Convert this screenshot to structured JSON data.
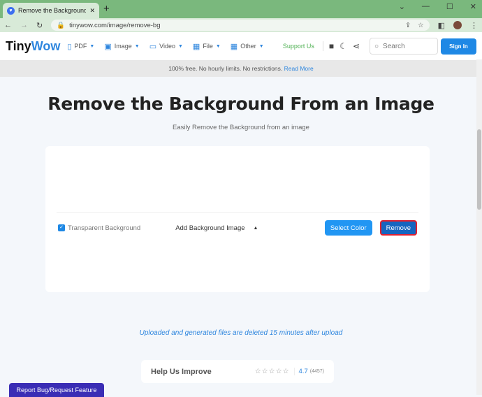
{
  "browser": {
    "tab_title": "Remove the Background From an Image",
    "url": "tinywow.com/image/remove-bg",
    "new_tab": "+",
    "close": "✕"
  },
  "nav": {
    "logo_a": "Tiny",
    "logo_b": "Wow",
    "items": [
      {
        "label": "PDF",
        "icon": "📄"
      },
      {
        "label": "Image",
        "icon": "🖼"
      },
      {
        "label": "Video",
        "icon": "🎥"
      },
      {
        "label": "File",
        "icon": "▦"
      },
      {
        "label": "Other",
        "icon": "▦"
      }
    ],
    "support": "Support Us",
    "search_placeholder": "Search",
    "signin": "Sign In"
  },
  "banner": {
    "text": "100% free. No hourly limits. No restrictions.",
    "link": "Read More"
  },
  "main": {
    "title": "Remove the Background From an Image",
    "subtitle": "Easily Remove the Background from an image"
  },
  "options": {
    "transparent": "Transparent Background",
    "add_bg": "Add Background Image",
    "select_color": "Select Color",
    "remove": "Remove"
  },
  "note": "Uploaded and generated files are deleted 15 minutes after upload",
  "feedback": {
    "title": "Help Us Improve",
    "rating": "4.7",
    "count": "(4457)"
  },
  "report": "Report Bug/Request Feature"
}
